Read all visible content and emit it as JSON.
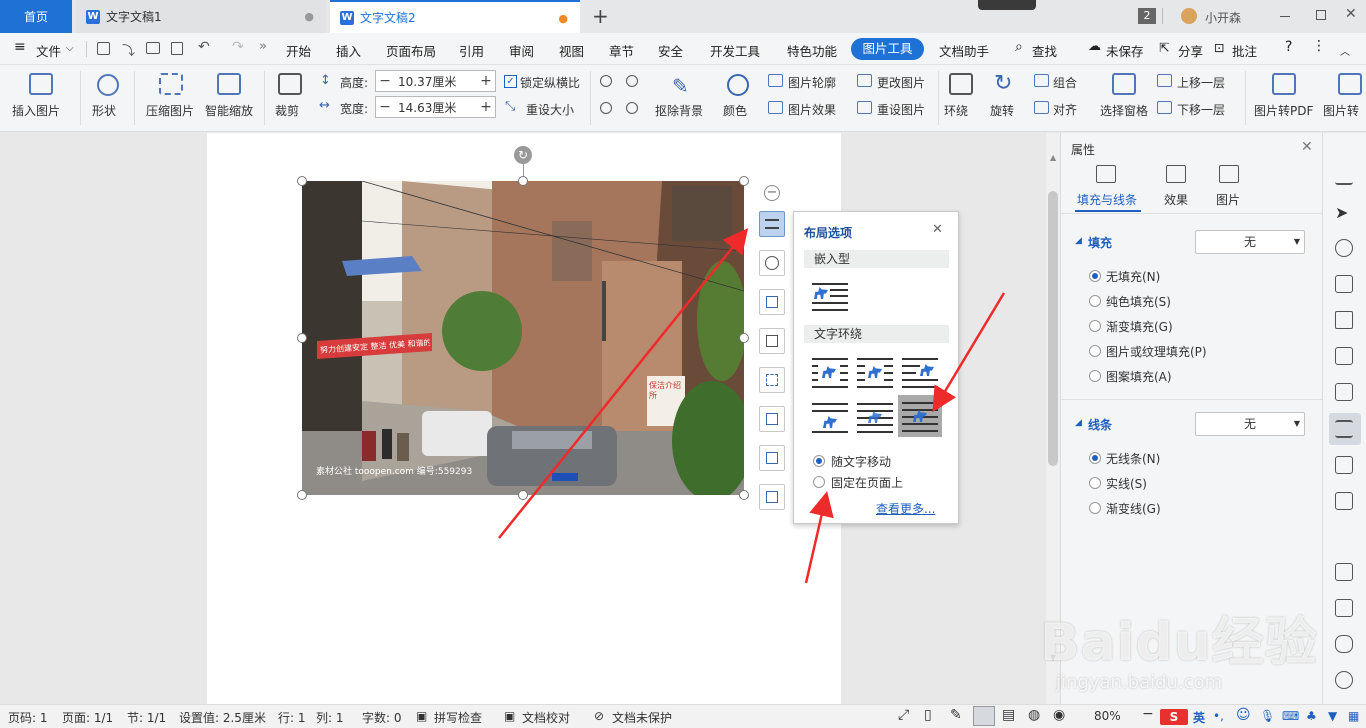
{
  "tabs": {
    "home": "首页",
    "doc1": "文字文稿1",
    "doc2": "文字文稿2",
    "doc_icon": "W",
    "add": "+"
  },
  "titlebar": {
    "badge": "2",
    "user": "小开森"
  },
  "menu": {
    "file": "文件",
    "items": [
      "开始",
      "插入",
      "页面布局",
      "引用",
      "审阅",
      "视图",
      "章节",
      "安全",
      "开发工具",
      "特色功能"
    ],
    "picture_tools": "图片工具",
    "doc_helper": "文档助手",
    "find": "查找",
    "unsaved": "未保存",
    "share": "分享",
    "comment": "批注"
  },
  "ribbon": {
    "insert_picture": "插入图片",
    "shape": "形状",
    "compress": "压缩图片",
    "smart_zoom": "智能缩放",
    "crop": "裁剪",
    "height_label": "高度:",
    "height_value": "10.37厘米",
    "width_label": "宽度:",
    "width_value": "14.63厘米",
    "lock_ratio": "锁定纵横比",
    "reset_size": "重设大小",
    "remove_bg": "抠除背景",
    "color": "颜色",
    "outline": "图片轮廓",
    "change_pic": "更改图片",
    "effects": "图片效果",
    "reset_pic": "重设图片",
    "wrap": "环绕",
    "rotate": "旋转",
    "group": "组合",
    "align": "对齐",
    "select_pane": "选择窗格",
    "bring_forward": "上移一层",
    "send_backward": "下移一层",
    "to_pdf": "图片转PDF",
    "pic_more": "图片转"
  },
  "photo": {
    "banner": "努力创建安定 整洁 优美 和谐的文明小区",
    "sign": "保洁介绍所",
    "watermark": "素材公社 tooopen.com 编号:559293"
  },
  "layout_popup": {
    "title": "布局选项",
    "inline_section": "嵌入型",
    "wrap_section": "文字环绕",
    "move_with_text": "随文字移动",
    "fixed_on_page": "固定在页面上",
    "see_more": "查看更多..."
  },
  "properties": {
    "title": "属性",
    "tab_fill": "填充与线条",
    "tab_effects": "效果",
    "tab_picture": "图片",
    "fill_section": "填充",
    "fill_value": "无",
    "fill_options": [
      "无填充(N)",
      "纯色填充(S)",
      "渐变填充(G)",
      "图片或纹理填充(P)",
      "图案填充(A)"
    ],
    "line_section": "线条",
    "line_value": "无",
    "line_options": [
      "无线条(N)",
      "实线(S)",
      "渐变线(G)"
    ]
  },
  "status": {
    "page_no": "页码: 1",
    "pages": "页面: 1/1",
    "section": "节: 1/1",
    "setting": "设置值: 2.5厘米",
    "row": "行: 1",
    "col": "列: 1",
    "words": "字数: 0",
    "spellcheck": "拼写检查",
    "proofread": "文档校对",
    "unprotected": "文档未保护",
    "zoom": "80%",
    "ime": "英"
  },
  "watermark_text": "Baidu经验",
  "watermark_sub": "jingyan.baidu.com",
  "colors": {
    "accent": "#1e72d6",
    "arrow": "#ee2a2a"
  }
}
